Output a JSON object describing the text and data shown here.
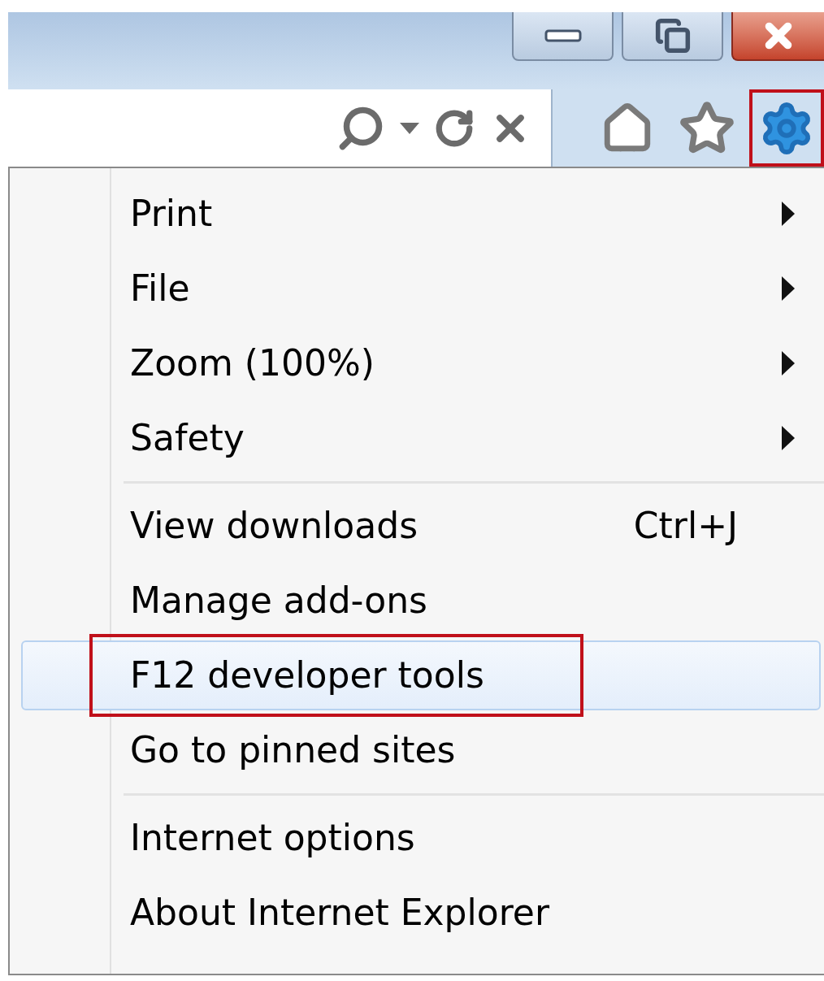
{
  "title_bar": {
    "buttons": [
      {
        "kind": "minimize"
      },
      {
        "kind": "restore"
      },
      {
        "kind": "close"
      }
    ]
  },
  "address_bar": {
    "icons": [
      {
        "kind": "search"
      },
      {
        "kind": "dropdown"
      },
      {
        "kind": "refresh"
      },
      {
        "kind": "stop"
      }
    ]
  },
  "toolbar": {
    "icons": [
      {
        "kind": "home",
        "annotated": false
      },
      {
        "kind": "favorites",
        "annotated": false
      },
      {
        "kind": "tools",
        "annotated": true
      }
    ]
  },
  "menu": {
    "items": [
      {
        "kind": "item",
        "label": "Print",
        "submenu": true,
        "selected": false,
        "annotated": false
      },
      {
        "kind": "item",
        "label": "File",
        "submenu": true,
        "selected": false,
        "annotated": false
      },
      {
        "kind": "item",
        "label": "Zoom (100%)",
        "submenu": true,
        "selected": false,
        "annotated": false
      },
      {
        "kind": "item",
        "label": "Safety",
        "submenu": true,
        "selected": false,
        "annotated": false
      },
      {
        "kind": "separator"
      },
      {
        "kind": "item",
        "label": "View downloads",
        "shortcut": "Ctrl+J",
        "submenu": false,
        "selected": false,
        "annotated": false
      },
      {
        "kind": "item",
        "label": "Manage add-ons",
        "submenu": false,
        "selected": false,
        "annotated": false
      },
      {
        "kind": "item",
        "label": "F12 developer tools",
        "submenu": false,
        "selected": true,
        "annotated": true
      },
      {
        "kind": "item",
        "label": "Go to pinned sites",
        "submenu": false,
        "selected": false,
        "annotated": false
      },
      {
        "kind": "separator"
      },
      {
        "kind": "item",
        "label": "Internet options",
        "submenu": false,
        "selected": false,
        "annotated": false
      },
      {
        "kind": "item",
        "label": "About Internet Explorer",
        "submenu": false,
        "selected": false,
        "annotated": false
      }
    ]
  }
}
